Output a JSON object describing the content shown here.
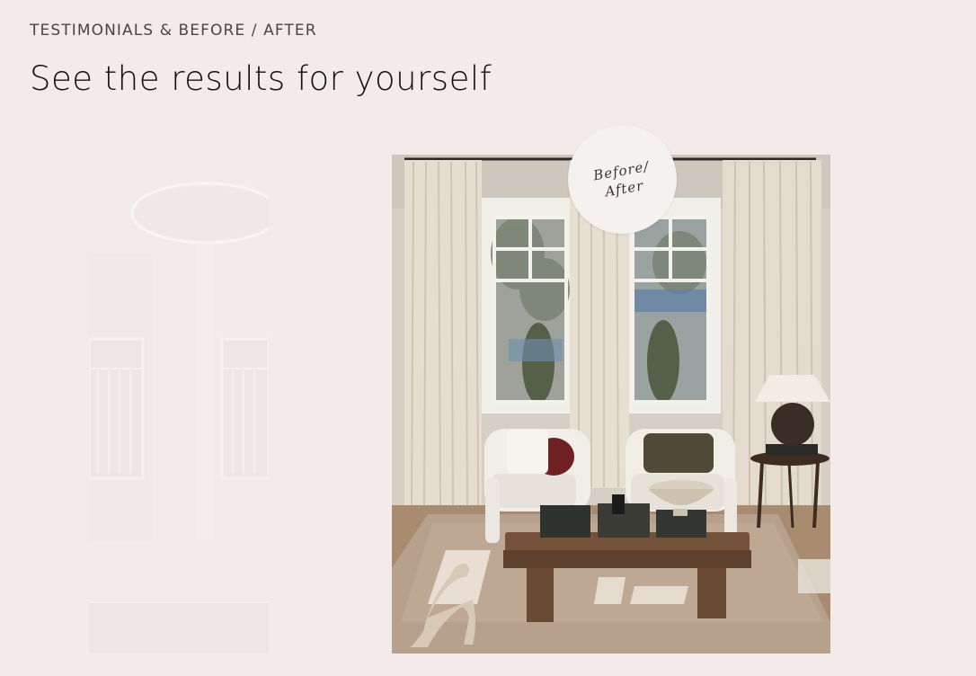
{
  "section": {
    "eyebrow": "TESTIMONIALS & BEFORE / AFTER",
    "headline": "See the results for yourself"
  },
  "badge": {
    "label": "Before/ After"
  },
  "colors": {
    "background": "#f3ebea",
    "badge_background": "#f5f1ef",
    "heading_text": "#111111",
    "eyebrow_text": "#4a4542"
  }
}
